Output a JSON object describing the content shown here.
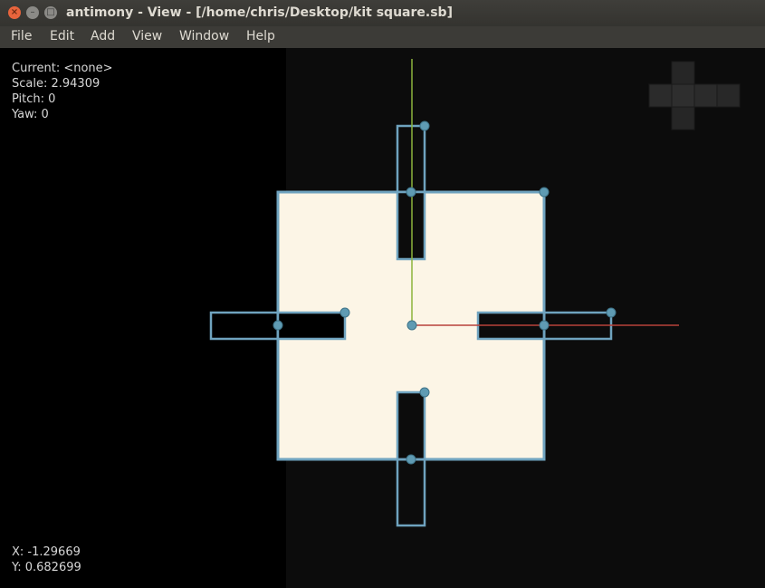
{
  "window": {
    "title": "antimony - View - [/home/chris/Desktop/kit square.sb]",
    "close_glyph": "×",
    "minimize_glyph": "–",
    "maximize_glyph": "□"
  },
  "menu": [
    "File",
    "Edit",
    "Add",
    "View",
    "Window",
    "Help"
  ],
  "hud": {
    "current": "Current: <none>",
    "scale": "Scale: 2.94309",
    "pitch": "Pitch: 0",
    "yaw": "Yaw: 0"
  },
  "cursor": {
    "x": "X: -1.29669",
    "y": "Y: 0.682699"
  },
  "colors": {
    "outline": "#6fa3bf",
    "fill": "#fcf5e6",
    "handle": "#5f9bb3",
    "x_axis": "#b8423a",
    "y_axis": "#8cb43c"
  },
  "icons": [
    "close-icon",
    "minimize-icon",
    "maximize-icon"
  ]
}
